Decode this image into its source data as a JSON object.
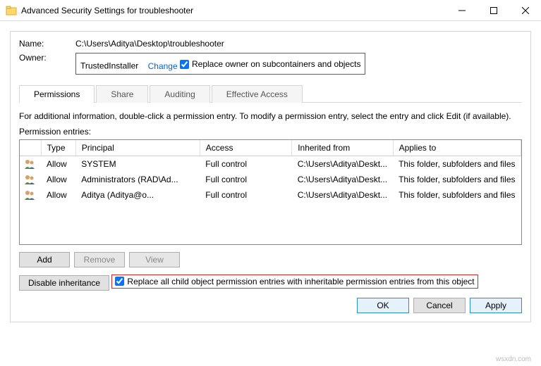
{
  "window": {
    "title": "Advanced Security Settings for troubleshooter"
  },
  "labels": {
    "name": "Name:",
    "owner": "Owner:"
  },
  "values": {
    "path": "C:\\Users\\Aditya\\Desktop\\troubleshooter",
    "owner": "TrustedInstaller",
    "change": "Change",
    "replace_owner": "Replace owner on subcontainers and objects"
  },
  "tabs": {
    "permissions": "Permissions",
    "share": "Share",
    "auditing": "Auditing",
    "effective": "Effective Access"
  },
  "main": {
    "info": "For additional information, double-click a permission entry. To modify a permission entry, select the entry and click Edit (if available).",
    "entries_label": "Permission entries:"
  },
  "headers": {
    "type": "Type",
    "principal": "Principal",
    "access": "Access",
    "inherited": "Inherited from",
    "applies": "Applies to"
  },
  "rows": [
    {
      "type": "Allow",
      "principal": "SYSTEM",
      "access": "Full control",
      "inherited": "C:\\Users\\Aditya\\Deskt...",
      "applies": "This folder, subfolders and files"
    },
    {
      "type": "Allow",
      "principal": "Administrators (RAD\\Ad...",
      "access": "Full control",
      "inherited": "C:\\Users\\Aditya\\Deskt...",
      "applies": "This folder, subfolders and files"
    },
    {
      "type": "Allow",
      "principal": "Aditya (Aditya@o...",
      "access": "Full control",
      "inherited": "C:\\Users\\Aditya\\Deskt...",
      "applies": "This folder, subfolders and files"
    }
  ],
  "buttons": {
    "add": "Add",
    "remove": "Remove",
    "view": "View",
    "disable_inheritance": "Disable inheritance",
    "replace_children": "Replace all child object permission entries with inheritable permission entries from this object",
    "ok": "OK",
    "cancel": "Cancel",
    "apply": "Apply"
  },
  "watermark": "wsxdn.com"
}
